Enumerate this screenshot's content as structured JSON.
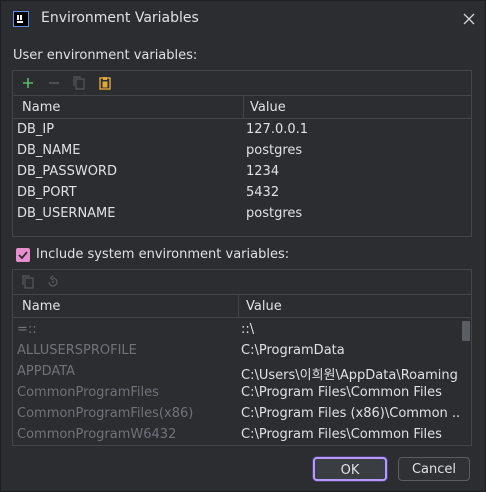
{
  "window": {
    "title": "Environment Variables"
  },
  "user_section": {
    "label": "User environment variables:",
    "columns": [
      "Name",
      "Value"
    ],
    "rows": [
      {
        "name": "DB_IP",
        "value": "127.0.0.1"
      },
      {
        "name": "DB_NAME",
        "value": "postgres"
      },
      {
        "name": "DB_PASSWORD",
        "value": "1234"
      },
      {
        "name": "DB_PORT",
        "value": "5432"
      },
      {
        "name": "DB_USERNAME",
        "value": "postgres"
      }
    ],
    "toolbar_icons": [
      "add-icon",
      "remove-icon",
      "copy-icon",
      "paste-icon"
    ]
  },
  "system_section": {
    "checkbox_label": "Include system environment variables:",
    "checked": true,
    "columns": [
      "Name",
      "Value"
    ],
    "rows": [
      {
        "name": "=::",
        "value": "::\\"
      },
      {
        "name": "ALLUSERSPROFILE",
        "value": "C:\\ProgramData"
      },
      {
        "name": "APPDATA",
        "value": "C:\\Users\\이희원\\AppData\\Roaming"
      },
      {
        "name": "CommonProgramFiles",
        "value": "C:\\Program Files\\Common Files"
      },
      {
        "name": "CommonProgramFiles(x86)",
        "value": "C:\\Program Files (x86)\\Common ..."
      },
      {
        "name": "CommonProgramW6432",
        "value": "C:\\Program Files\\Common Files"
      }
    ],
    "toolbar_icons": [
      "copy-icon",
      "revert-icon"
    ]
  },
  "buttons": {
    "ok": "OK",
    "cancel": "Cancel"
  },
  "colors": {
    "accent": "#b799ff",
    "checkbox": "#e88fd0",
    "add": "#5fb865",
    "paste": "#e0a73a"
  }
}
